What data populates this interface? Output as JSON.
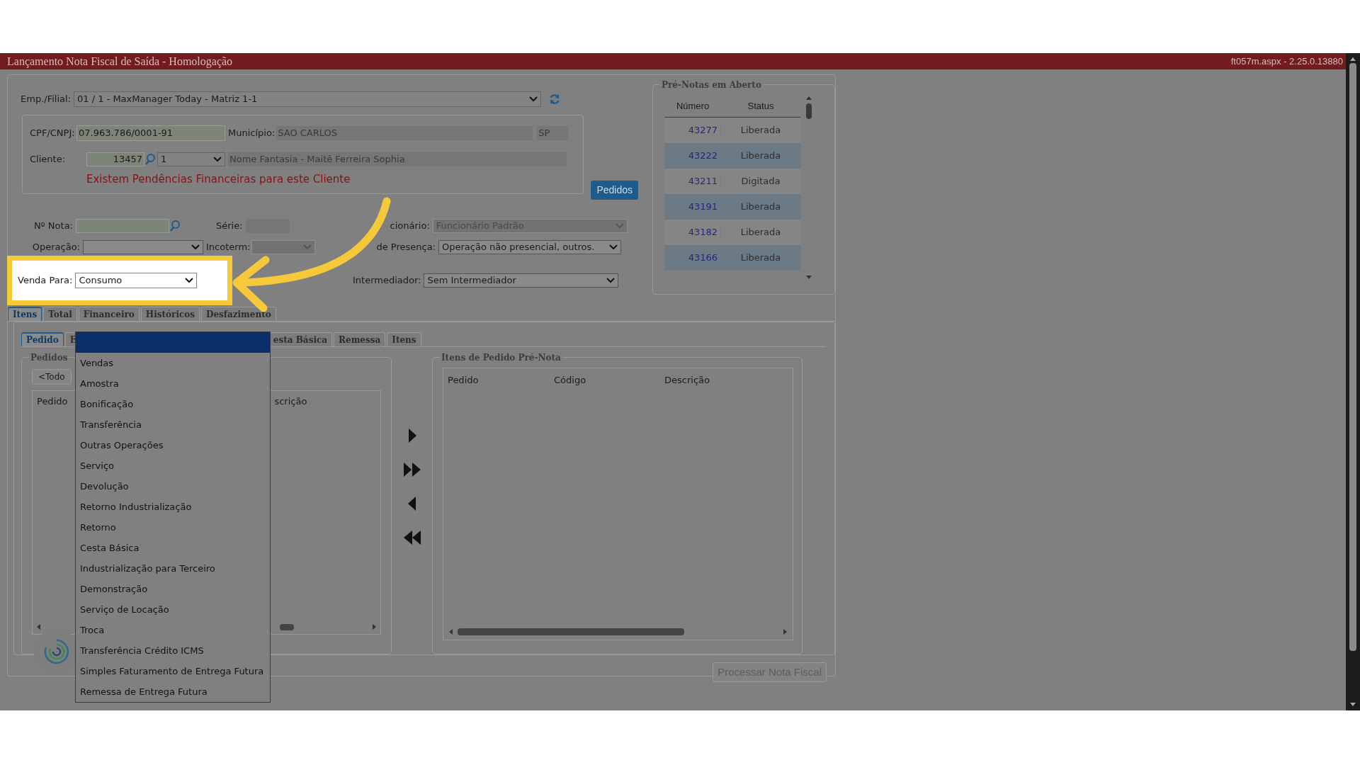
{
  "header": {
    "title": "Lançamento Nota Fiscal de Saída  - Homologação",
    "version": "ft057m.aspx - 2.25.0.13880"
  },
  "form": {
    "emp_filial": {
      "label": "Emp./Filial:",
      "value": "01 / 1 - MaxManager Today - Matriz 1-1"
    },
    "cpf_cnpj": {
      "label": "CPF/CNPJ:",
      "value": "07.963.786/0001-91"
    },
    "municipio": {
      "label": "Município:",
      "value": "SAO CARLOS",
      "uf": "SP"
    },
    "cliente": {
      "label": "Cliente:",
      "code": "13457",
      "seq": "1",
      "name": "Nome Fantasia - Maitê Ferreira Sophia"
    },
    "alert": "Existem Pendências Financeiras para este Cliente",
    "pedidos_button": "Pedidos",
    "numero_nota": {
      "label": "Nº Nota:"
    },
    "serie": {
      "label": "Série:"
    },
    "funcionario": {
      "label": "cionário:",
      "value": "Funcionário Padrão",
      "disabled": true
    },
    "operacao": {
      "label": "Operação:",
      "disabled": false
    },
    "incoterm": {
      "label": "Incoterm:",
      "disabled": true
    },
    "presenca": {
      "label": "de Presença:",
      "value": "Operação não presencial, outros.",
      "disabled": false
    },
    "venda_para": {
      "label": "Venda Para:",
      "value": "Consumo"
    },
    "intermediador": {
      "label": "Intermediador:",
      "value": "Sem Intermediador",
      "disabled": false
    }
  },
  "pre_notas": {
    "title": "Pré-Notas em Aberto",
    "columns": [
      "Número",
      "Status"
    ],
    "rows": [
      {
        "numero": "43277",
        "status": "Liberada"
      },
      {
        "numero": "43222",
        "status": "Liberada"
      },
      {
        "numero": "43211",
        "status": "Digitada"
      },
      {
        "numero": "43191",
        "status": "Liberada"
      },
      {
        "numero": "43182",
        "status": "Liberada"
      },
      {
        "numero": "43166",
        "status": "Liberada"
      }
    ]
  },
  "tabs": [
    {
      "label": "Itens",
      "selected": true
    },
    {
      "label": "Total",
      "selected": false
    },
    {
      "label": "Financeiro",
      "selected": false
    },
    {
      "label": "Históricos",
      "selected": false
    },
    {
      "label": "Desfazimento",
      "selected": false
    }
  ],
  "subtabs": [
    {
      "label": "Pedido",
      "selected": true
    },
    {
      "label": "E",
      "selected": false
    },
    {
      "label": "esta Básica",
      "selected": false
    },
    {
      "label": "Remessa",
      "selected": false
    },
    {
      "label": "Itens",
      "selected": false
    }
  ],
  "pedidos_panel": {
    "legend": "Pedidos",
    "filter_button": "<Todo",
    "columns": [
      "Pedido",
      "scrição"
    ]
  },
  "itens_panel": {
    "legend": "Itens de Pedido Pré-Nota",
    "columns": [
      "Pedido",
      "Código",
      "Descrição"
    ]
  },
  "process_button": {
    "label": "Processar Nota Fiscal",
    "disabled": true
  },
  "dropdown": {
    "blank_option": {
      "selected": true
    },
    "options": [
      {
        "label": "Vendas",
        "selected": false
      },
      {
        "label": "Amostra",
        "selected": false
      },
      {
        "label": "Bonificação",
        "selected": false
      },
      {
        "label": "Transferência",
        "selected": false
      },
      {
        "label": "Outras Operações",
        "selected": false
      },
      {
        "label": "Serviço",
        "selected": false
      },
      {
        "label": "Devolução",
        "selected": false
      },
      {
        "label": "Retorno Industrialização",
        "selected": false
      },
      {
        "label": "Retorno",
        "selected": false
      },
      {
        "label": "Cesta Básica",
        "selected": false
      },
      {
        "label": "Industrialização para Terceiro",
        "selected": false
      },
      {
        "label": "Demonstração",
        "selected": false
      },
      {
        "label": "Serviço de Locação",
        "selected": false
      },
      {
        "label": "Troca",
        "selected": false
      },
      {
        "label": "Transferência Crédito ICMS",
        "selected": false
      },
      {
        "label": "Simples Faturamento de Entrega Futura",
        "selected": false
      },
      {
        "label": "Remessa de Entrega Futura",
        "selected": false
      }
    ]
  }
}
